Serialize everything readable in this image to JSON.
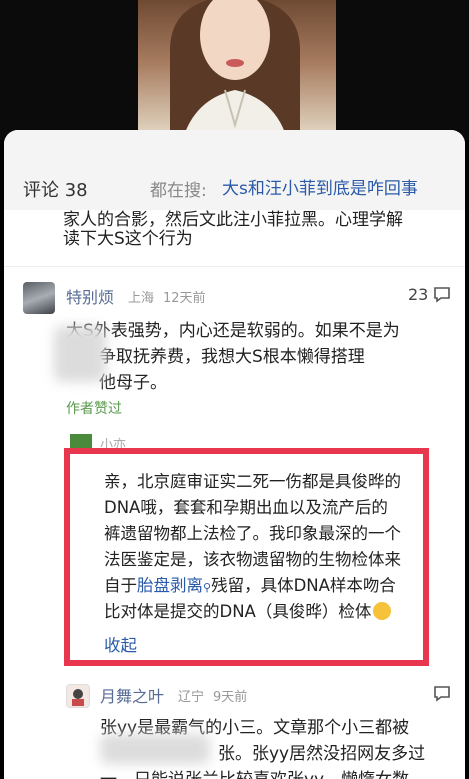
{
  "header": {
    "comments_label": "评论 38",
    "search_label": "都在搜:",
    "search_query": "大s和汪小菲到底是咋回事"
  },
  "prev_comment": {
    "line1": "家人的合影，然后文此注小菲拉黑。心理学解",
    "line2": "读下大S这个行为"
  },
  "comment1": {
    "username": "特别烦",
    "location": "上海",
    "time": "12天前",
    "likes": "23",
    "line1": "大S外表强势，内心还是软弱的。如果不是为",
    "line2": "争取抚养费，我想大S根本懒得搭理",
    "line3": "他母子。",
    "author_liked": "作者赞过"
  },
  "reply": {
    "username": "小亦",
    "lines": [
      "亲，北京庭审证实二死一伤都是具俊晔的",
      "DNA哦，套套和孕期出血以及流产后的",
      "裤遗留物都上法检了。我印象最深的一个",
      "法医鉴定是，该衣物遗留物的生物检体来",
      "残留，具体DNA样本吻合",
      "比对体是提交的DNA（具俊晔）检体"
    ],
    "prefix5": "自于",
    "link": "胎盘剥离",
    "collapse_label": "收起"
  },
  "comment2": {
    "username": "月舞之叶",
    "location": "辽宁",
    "time": "9天前",
    "line1": "张yy是最霸气的小三。文章那个小三都被",
    "line2": "张。张yy居然没招网友多过",
    "line3": "一，只能说张兰比较喜欢张yy，懒惰女数"
  },
  "colors": {
    "highlight_border": "#e8364f",
    "link": "#2a5aa8",
    "username": "#576b95",
    "liked": "#5a9a4b"
  }
}
